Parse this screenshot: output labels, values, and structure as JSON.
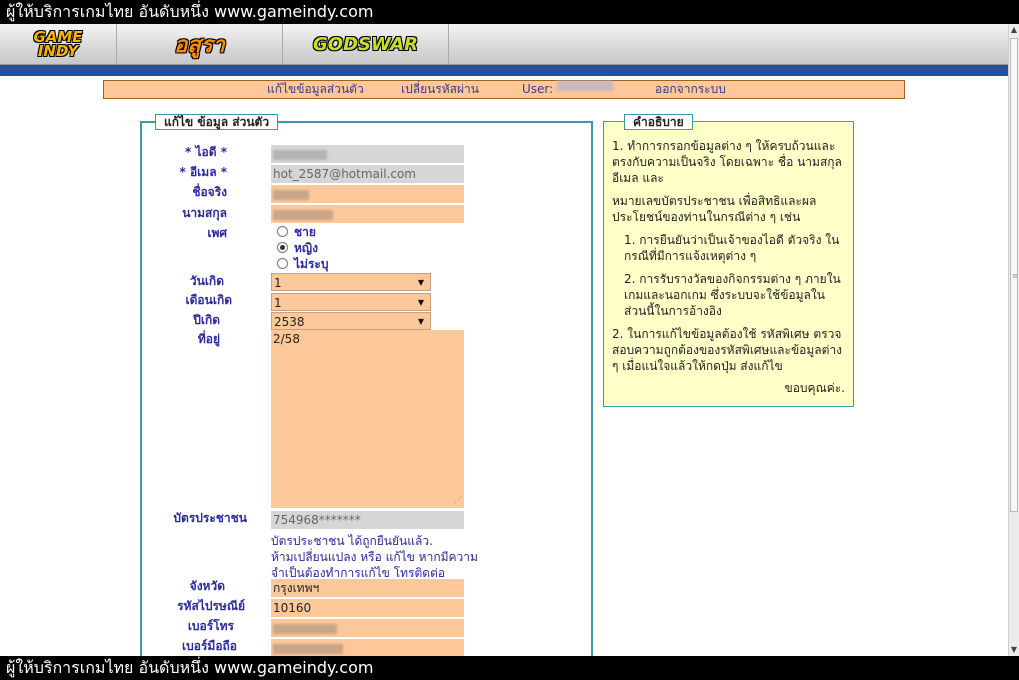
{
  "banner_text": "ผู้ให้บริการเกมไทย อันดับหนึ่ง www.gameindy.com",
  "game_tabs": [
    {
      "name": "GAME INDY",
      "line1": "GAME",
      "line2": "INDY"
    },
    {
      "name": "อสูรา",
      "label": "อสูรา"
    },
    {
      "name": "GODSWAR",
      "label": "GODSWAR"
    }
  ],
  "menu": {
    "edit_profile": "แก้ไขข้อมูลส่วนตัว",
    "change_password": "เปลี่ยนรหัสผ่าน",
    "user_label": "User:",
    "logout": "ออกจากระบบ"
  },
  "form": {
    "legend": "แก้ไข ข้อมูล ส่วนตัว",
    "labels": {
      "id": "* ไอดี *",
      "email": "* อีเมล *",
      "first_name": "ชื่อจริง",
      "last_name": "นามสกุล",
      "gender": "เพศ",
      "birth_day": "วันเกิด",
      "birth_month": "เดือนเกิด",
      "birth_year": "ปีเกิด",
      "address": "ที่อยู่",
      "citizen_id": "บัตรประชาชน",
      "province": "จังหวัด",
      "postcode": "รหัสไปรษณีย์",
      "phone": "เบอร์โทร",
      "mobile": "เบอร์มือถือ"
    },
    "values": {
      "email": "hot_2587@hotmail.com",
      "birth_day": "1",
      "birth_month": "1",
      "birth_year": "2538",
      "address": "2/58",
      "citizen_id": "754968*******",
      "province": "กรุงเทพฯ",
      "postcode": "10160"
    },
    "gender_options": [
      {
        "label": "ชาย",
        "checked": false
      },
      {
        "label": "หญิง",
        "checked": true
      },
      {
        "label": "ไม่ระบุ",
        "checked": false
      }
    ],
    "citizen_note": [
      "บัตรประชาชน ได้ถูกยืนยันแล้ว.",
      "ห้ามเปลี่ยนแปลง หรือ แก้ไข หากมีความ",
      "จำเป็นต้องทำการแก้ไข โทรติดต่อ"
    ]
  },
  "help": {
    "legend": "คำอธิบาย",
    "p1": "1. ทำการกรอกข้อมูลต่าง ๆ ให้ครบถ้วนและตรงกับความเป็นจริง โดยเฉพาะ ชื่อ นามสกุล อีเมล และ",
    "p2": "หมายเลขบัตรประชาชน เพื่อสิทธิและผลประโยชน์ของท่านในกรณีต่าง ๆ เช่น",
    "p3": "1. การยืนยันว่าเป็นเจ้าของไอดี ตัวจริง ในกรณีที่มีการแจ้งเหตุต่าง ๆ",
    "p4": "2. การรับรางวัลของกิจกรรมต่าง ๆ ภายในเกมและนอกเกม ซึ่งระบบจะใช้ข้อมูลในส่วนนี้ในการอ้างอิง",
    "p5": "2. ในการแก้ไขข้อมูลต้องใช้ รหัสพิเศษ ตรวจสอบความถูกต้องของรหัสพิเศษและข้อมูลต่าง ๆ เมื่อแน่ใจแล้วให้กดปุ่ม ส่งแก้ไข",
    "thanks": "ขอบคุณค่ะ."
  }
}
